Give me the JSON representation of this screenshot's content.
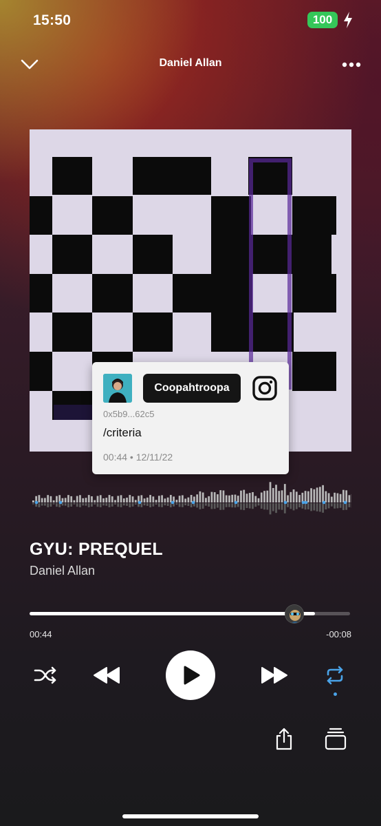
{
  "status_bar": {
    "time": "15:50",
    "battery": "100"
  },
  "header": {
    "title": "Daniel Allan",
    "back_icon": "chevron-down-icon",
    "more_icon": "more-icon"
  },
  "comment": {
    "username": "Coopahtroopa",
    "address": "0x5b9...62c5",
    "text": "/criteria",
    "meta": "00:44 • 12/11/22",
    "social_icon": "instagram-icon"
  },
  "track": {
    "title": "GYU: PREQUEL",
    "artist": "Daniel Allan"
  },
  "playback": {
    "elapsed": "00:44",
    "remaining": "-00:08",
    "progress": 0.89,
    "state": "paused",
    "repeat_active": true,
    "accent": "#4aa3e8"
  },
  "controls": [
    "shuffle-icon",
    "rewind-icon",
    "play-icon",
    "fast-forward-icon",
    "repeat-icon",
    "share-icon",
    "queue-icon"
  ]
}
